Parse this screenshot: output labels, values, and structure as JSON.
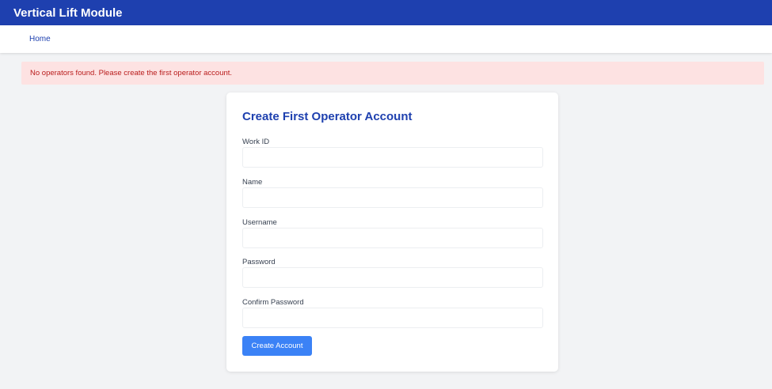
{
  "header": {
    "title": "Vertical Lift Module"
  },
  "nav": {
    "home": "Home"
  },
  "alert": {
    "message": "No operators found. Please create the first operator account."
  },
  "form": {
    "title": "Create First Operator Account",
    "fields": [
      {
        "label": "Work ID",
        "value": "",
        "type": "text"
      },
      {
        "label": "Name",
        "value": "",
        "type": "text"
      },
      {
        "label": "Username",
        "value": "",
        "type": "text"
      },
      {
        "label": "Password",
        "value": "",
        "type": "password"
      },
      {
        "label": "Confirm Password",
        "value": "",
        "type": "password"
      }
    ],
    "submit_label": "Create Account"
  },
  "colors": {
    "brand": "#1e40af",
    "button": "#3b82f6",
    "alert_bg": "#fde2e2",
    "alert_text": "#b91c1c",
    "page_bg": "#f2f3f5"
  }
}
